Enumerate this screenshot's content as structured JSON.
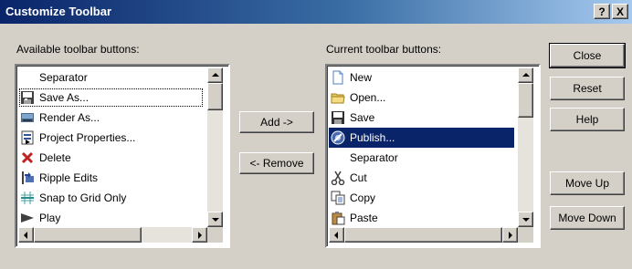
{
  "window": {
    "title": "Customize Toolbar",
    "help_label": "?",
    "close_label": "X"
  },
  "available": {
    "label": "Available toolbar buttons:",
    "items": [
      {
        "label": "Separator",
        "icon": "none"
      },
      {
        "label": "Save As...",
        "icon": "save-as-icon"
      },
      {
        "label": "Render As...",
        "icon": "render-icon"
      },
      {
        "label": "Project Properties...",
        "icon": "project-properties-icon"
      },
      {
        "label": "Delete",
        "icon": "delete-icon"
      },
      {
        "label": "Ripple Edits",
        "icon": "ripple-edits-icon"
      },
      {
        "label": "Snap to Grid Only",
        "icon": "snap-grid-icon"
      },
      {
        "label": "Play",
        "icon": "play-icon"
      }
    ]
  },
  "current": {
    "label": "Current toolbar buttons:",
    "items": [
      {
        "label": "New",
        "icon": "new-document-icon"
      },
      {
        "label": "Open...",
        "icon": "open-folder-icon"
      },
      {
        "label": "Save",
        "icon": "save-icon"
      },
      {
        "label": "Publish...",
        "icon": "publish-icon"
      },
      {
        "label": "Separator",
        "icon": "none"
      },
      {
        "label": "Cut",
        "icon": "scissors-icon"
      },
      {
        "label": "Copy",
        "icon": "copy-icon"
      },
      {
        "label": "Paste",
        "icon": "paste-icon"
      }
    ]
  },
  "buttons": {
    "add": "Add ->",
    "remove": "<- Remove",
    "close": "Close",
    "reset": "Reset",
    "help": "Help",
    "move_up": "Move Up",
    "move_down": "Move Down"
  },
  "colors": {
    "title_start": "#0a246a",
    "title_end": "#a6caf0",
    "selection": "#0a246a",
    "face": "#d4d0c8"
  }
}
